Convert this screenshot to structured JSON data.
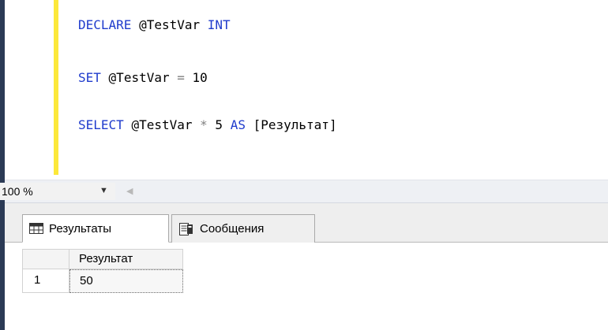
{
  "editor": {
    "line1": {
      "kw": "DECLARE",
      "var": "@TestVar",
      "type": "INT"
    },
    "line2": {
      "kw": "SET",
      "var": "@TestVar",
      "op": "=",
      "value": "10"
    },
    "line3": {
      "kw": "SELECT",
      "var": "@TestVar",
      "op": "*",
      "value": "5",
      "as": "AS",
      "alias": "[Результат]"
    }
  },
  "zoom": {
    "value": "100 %"
  },
  "tabs": {
    "results": "Результаты",
    "messages": "Сообщения"
  },
  "grid": {
    "column": "Результат",
    "rows": [
      {
        "num": "1",
        "value": "50"
      }
    ]
  },
  "icons": {
    "results_tab": "grid-icon",
    "messages_tab": "messages-icon",
    "zoom_dropdown": "chevron-down-icon",
    "scroll_left": "scroll-left-icon"
  },
  "colors": {
    "keyword": "#1f3bcc",
    "operator": "#808080",
    "change_bar": "#fce83a"
  }
}
